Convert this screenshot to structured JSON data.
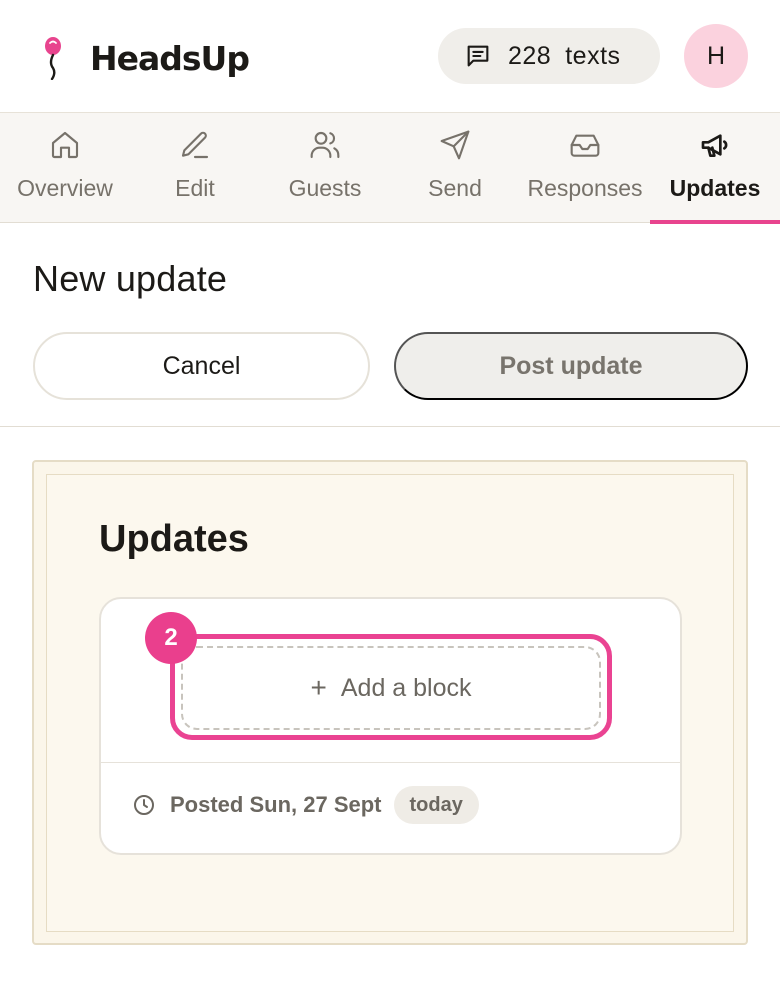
{
  "app": {
    "name": "HeadsUp",
    "accent_color": "#e8448e"
  },
  "header": {
    "credits": {
      "icon": "message-square-icon",
      "count": "228",
      "unit": "texts"
    },
    "avatar_initial": "H"
  },
  "tabs": [
    {
      "label": "Overview",
      "icon": "home-icon"
    },
    {
      "label": "Edit",
      "icon": "pencil-icon"
    },
    {
      "label": "Guests",
      "icon": "users-icon"
    },
    {
      "label": "Send",
      "icon": "send-icon"
    },
    {
      "label": "Responses",
      "icon": "inbox-icon"
    },
    {
      "label": "Updates",
      "icon": "megaphone-icon",
      "active": true
    }
  ],
  "page": {
    "title": "New update",
    "cancel_label": "Cancel",
    "post_label": "Post update"
  },
  "preview": {
    "title": "Updates",
    "step_badge": "2",
    "add_block_label": "Add a block",
    "posted_label": "Posted Sun, 27 Sept",
    "today_label": "today"
  }
}
